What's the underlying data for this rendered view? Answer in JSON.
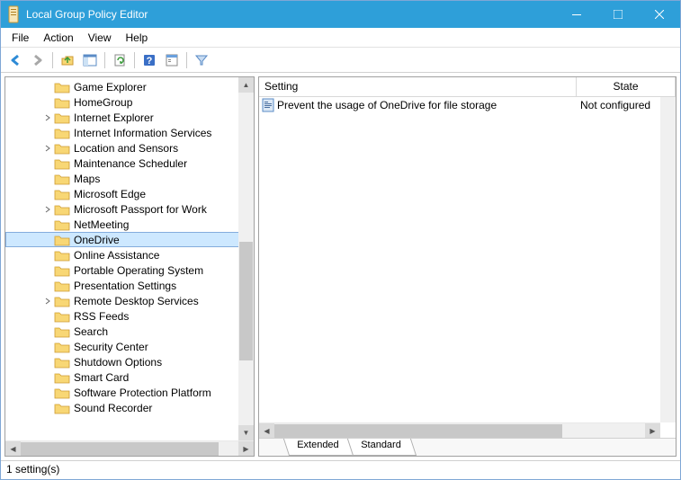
{
  "window": {
    "title": "Local Group Policy Editor"
  },
  "menu": {
    "file": "File",
    "action": "Action",
    "view": "View",
    "help": "Help"
  },
  "tree": {
    "items": [
      {
        "label": "Game Explorer",
        "expandable": false
      },
      {
        "label": "HomeGroup",
        "expandable": false
      },
      {
        "label": "Internet Explorer",
        "expandable": true
      },
      {
        "label": "Internet Information Services",
        "expandable": false
      },
      {
        "label": "Location and Sensors",
        "expandable": true
      },
      {
        "label": "Maintenance Scheduler",
        "expandable": false
      },
      {
        "label": "Maps",
        "expandable": false
      },
      {
        "label": "Microsoft Edge",
        "expandable": false
      },
      {
        "label": "Microsoft Passport for Work",
        "expandable": true
      },
      {
        "label": "NetMeeting",
        "expandable": false
      },
      {
        "label": "OneDrive",
        "expandable": false,
        "selected": true
      },
      {
        "label": "Online Assistance",
        "expandable": false
      },
      {
        "label": "Portable Operating System",
        "expandable": false
      },
      {
        "label": "Presentation Settings",
        "expandable": false
      },
      {
        "label": "Remote Desktop Services",
        "expandable": true
      },
      {
        "label": "RSS Feeds",
        "expandable": false
      },
      {
        "label": "Search",
        "expandable": false
      },
      {
        "label": "Security Center",
        "expandable": false
      },
      {
        "label": "Shutdown Options",
        "expandable": false
      },
      {
        "label": "Smart Card",
        "expandable": false
      },
      {
        "label": "Software Protection Platform",
        "expandable": false
      },
      {
        "label": "Sound Recorder",
        "expandable": false
      }
    ]
  },
  "list": {
    "headers": {
      "setting": "Setting",
      "state": "State"
    },
    "rows": [
      {
        "setting": "Prevent the usage of OneDrive for file storage",
        "state": "Not configured"
      }
    ]
  },
  "tabs": {
    "extended": "Extended",
    "standard": "Standard"
  },
  "status": "1 setting(s)"
}
